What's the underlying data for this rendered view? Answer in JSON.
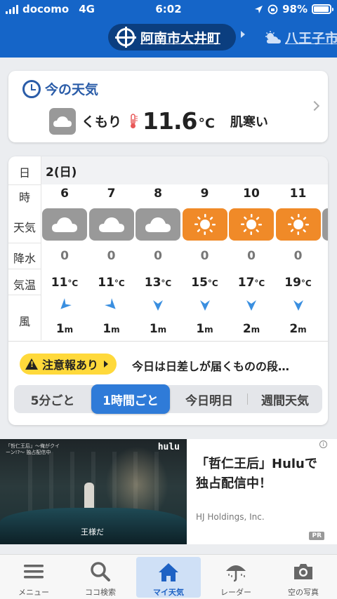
{
  "status_bar": {
    "carrier": "docomo",
    "network": "4G",
    "time": "6:02",
    "battery": "98%"
  },
  "header": {
    "location": "阿南市大井町",
    "next_location": "八王子市"
  },
  "current": {
    "title": "今の天気",
    "weather": "くもり",
    "temperature": "11.6",
    "unit": "°C",
    "feeling": "肌寒い",
    "icon": "cloud-icon"
  },
  "hourly": {
    "row_labels": {
      "date": "日",
      "hour": "時",
      "weather": "天気",
      "rain": "降水",
      "temp": "気温",
      "wind": "風"
    },
    "date": "2(日)",
    "columns": [
      {
        "hour": "6",
        "icon": "cloud",
        "rain": "0",
        "temp": "11",
        "temp_unit": "°C",
        "wind_dir": "NE",
        "wind_speed": "1",
        "wind_unit": "m"
      },
      {
        "hour": "7",
        "icon": "cloud",
        "rain": "0",
        "temp": "11",
        "temp_unit": "°C",
        "wind_dir": "NW",
        "wind_speed": "1",
        "wind_unit": "m"
      },
      {
        "hour": "8",
        "icon": "cloud",
        "rain": "0",
        "temp": "13",
        "temp_unit": "°C",
        "wind_dir": "N",
        "wind_speed": "1",
        "wind_unit": "m"
      },
      {
        "hour": "9",
        "icon": "sun",
        "rain": "0",
        "temp": "15",
        "temp_unit": "°C",
        "wind_dir": "N",
        "wind_speed": "1",
        "wind_unit": "m"
      },
      {
        "hour": "10",
        "icon": "sun",
        "rain": "0",
        "temp": "17",
        "temp_unit": "°C",
        "wind_dir": "N",
        "wind_speed": "2",
        "wind_unit": "m"
      },
      {
        "hour": "11",
        "icon": "sun",
        "rain": "0",
        "temp": "19",
        "temp_unit": "°C",
        "wind_dir": "N",
        "wind_speed": "2",
        "wind_unit": "m"
      }
    ],
    "colors": {
      "cloud": "#999999",
      "sun": "#f08a28",
      "wind": "#3a8fe0"
    }
  },
  "warning": {
    "badge": "注意報あり",
    "text": "今日は日差しが届くものの段…"
  },
  "tabs": [
    {
      "label": "5分ごと",
      "active": false
    },
    {
      "label": "1時間ごと",
      "active": true
    },
    {
      "label": "今日明日",
      "active": false
    },
    {
      "label": "週間天気",
      "active": false
    }
  ],
  "ad": {
    "image_tag": "「哲仁王后」～俺がクイーン!?～ 独占配信中",
    "brand": "hulu",
    "subtitle": "王様だ",
    "title": "「哲仁王后」Huluで独占配信中！",
    "company": "HJ Holdings, Inc.",
    "pr": "PR",
    "info": "i"
  },
  "nav": [
    {
      "label": "メニュー",
      "icon": "menu-icon"
    },
    {
      "label": "ココ検索",
      "icon": "search-icon"
    },
    {
      "label": "マイ天気",
      "icon": "home-icon",
      "active": true
    },
    {
      "label": "レーダー",
      "icon": "umbrella-icon"
    },
    {
      "label": "空の写真",
      "icon": "camera-icon"
    }
  ],
  "accent_color": "#1565c8"
}
